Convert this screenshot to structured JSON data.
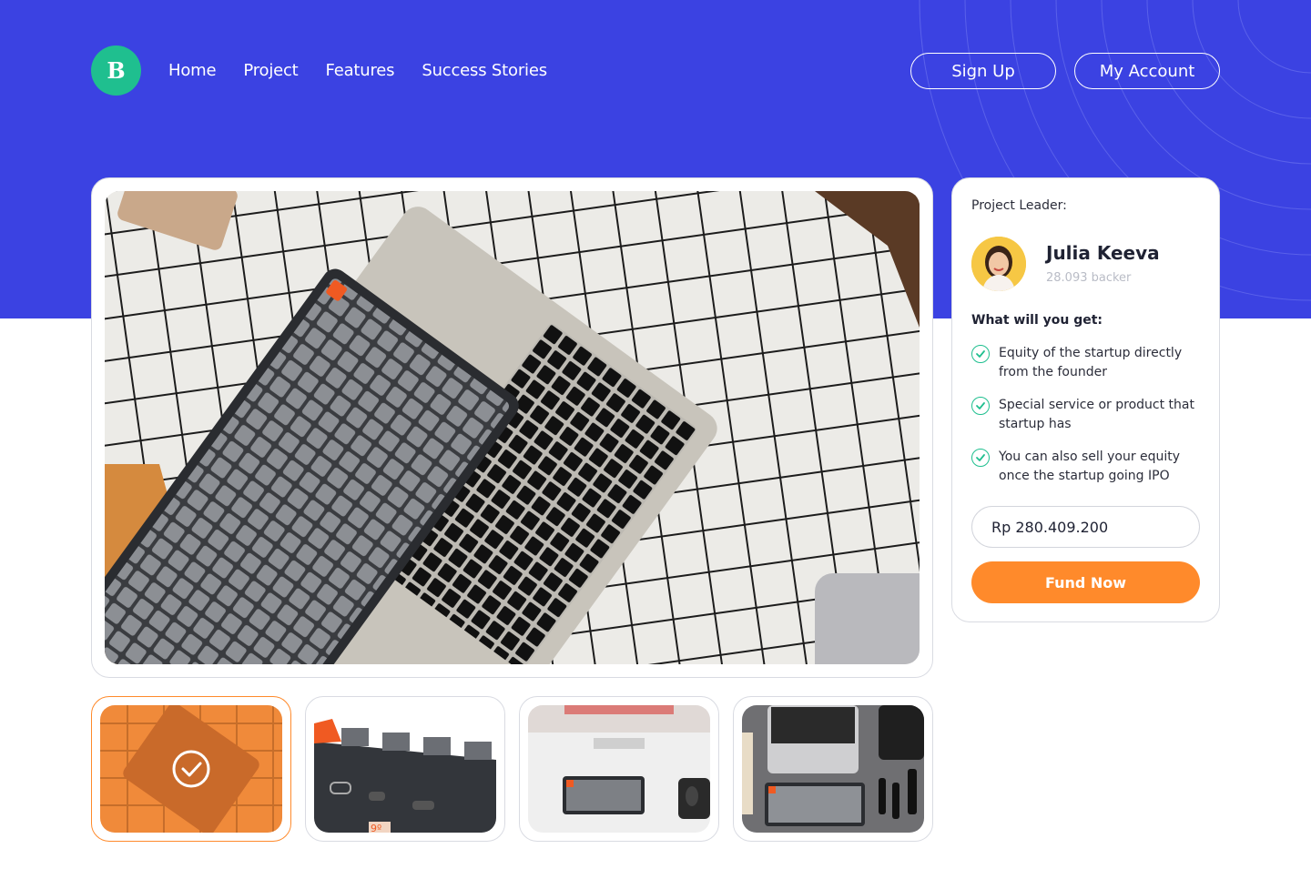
{
  "brand": {
    "logo_letter": "B",
    "color": "#1fbf8f"
  },
  "header": {
    "nav": [
      "Home",
      "Project",
      "Features",
      "Success Stories"
    ],
    "signup_label": "Sign Up",
    "account_label": "My Account"
  },
  "colors": {
    "hero": "#3b42e2",
    "accent": "#ff8a2b",
    "check": "#1fbf8f"
  },
  "gallery": {
    "main_image": "mechanical-keyboard-and-laptop-photo",
    "thumbnails": [
      {
        "image": "keyboard-top-view-photo",
        "selected": true
      },
      {
        "image": "keyboard-side-ports-photo",
        "selected": false
      },
      {
        "image": "desk-setup-keyboard-photo",
        "selected": false
      },
      {
        "image": "flatlay-laptop-keyboard-photo",
        "selected": false
      }
    ]
  },
  "leader": {
    "label": "Project Leader:",
    "name": "Julia Keeva",
    "backers": "28.093 backer"
  },
  "benefits": {
    "title": "What will you get:",
    "items": [
      "Equity of the startup directly from the founder",
      "Special service or product that startup has",
      "You can also sell your equity once the startup going IPO"
    ]
  },
  "fund": {
    "amount_value": "Rp 280.409.200",
    "button_label": "Fund Now"
  }
}
